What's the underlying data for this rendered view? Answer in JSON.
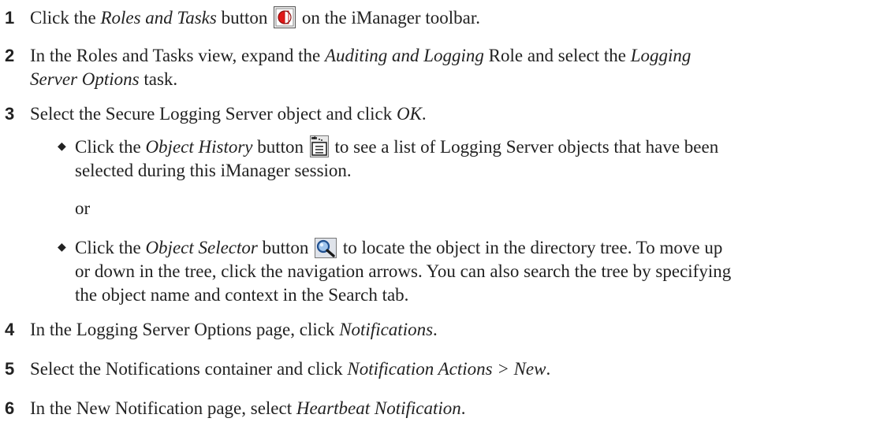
{
  "steps": [
    {
      "number": "1",
      "t1": "Click the ",
      "em1": "Roles and Tasks",
      "t2": " button ",
      "t3": " on the iManager toolbar.",
      "icon": "roles-and-tasks-icon"
    },
    {
      "number": "2",
      "t1": "In the Roles and Tasks view, expand the ",
      "em1": "Auditing and Logging",
      "t2": " Role and select the ",
      "em2": "Logging",
      "em3": "Server Options",
      "t3": " task."
    },
    {
      "number": "3",
      "t1": "Select the Secure Logging Server object and click ",
      "em1": "OK",
      "t2": "."
    },
    {
      "number": "4",
      "t1": "In the Logging Server Options page, click ",
      "em1": "Notifications",
      "t2": "."
    },
    {
      "number": "5",
      "t1": "Select the Notifications container and click ",
      "em1": "Notification Actions > New",
      "t2": "."
    },
    {
      "number": "6",
      "t1": "In the New Notification page, select ",
      "em1": "Heartbeat Notification",
      "t2": "."
    }
  ],
  "bullets": [
    {
      "glyph": "◆",
      "t1": "Click the ",
      "em1": "Object History",
      "t2": " button ",
      "t3": " to see a list of Logging Server objects that have been",
      "t4": "selected during this iManager session.",
      "icon": "object-history-icon"
    },
    {
      "glyph": "◆",
      "t1": "Click the ",
      "em1": "Object Selector",
      "t2": " button ",
      "t3": " to locate the object in the directory tree. To move up",
      "t4": "or down in the tree, click the navigation arrows. You can also search the tree by specifying",
      "t5": "the object name and context in the Search tab.",
      "icon": "object-selector-icon"
    }
  ],
  "or_text": "or"
}
